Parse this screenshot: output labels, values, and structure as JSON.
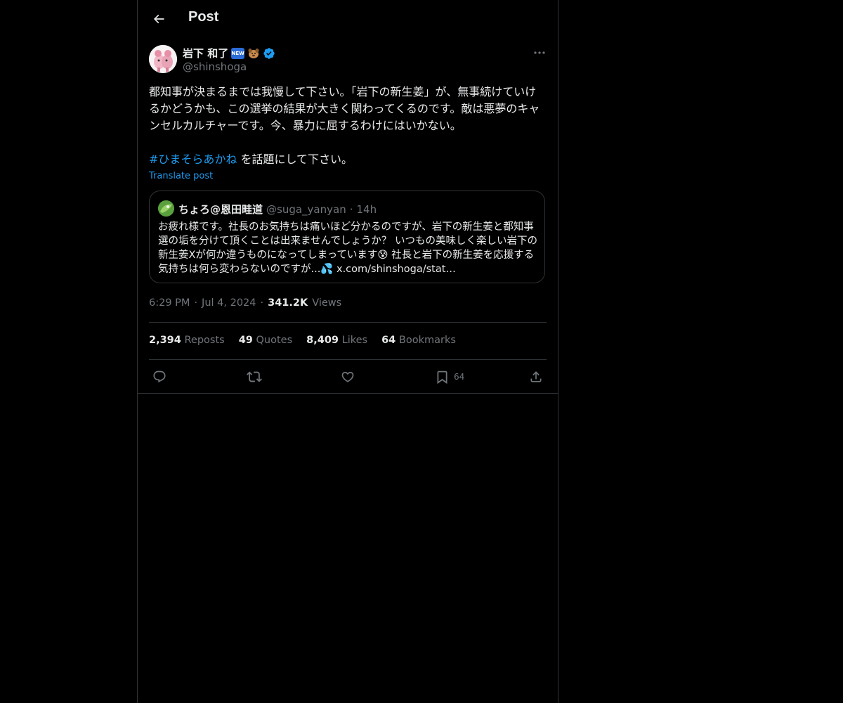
{
  "header": {
    "title": "Post"
  },
  "author": {
    "name": "岩下 和了",
    "badge_new": "NEW",
    "handle": "@shinshoga"
  },
  "post": {
    "text_main": "都知事が決まるまでは我慢して下さい。「岩下の新生姜」が、無事続けていけるかどうかも、この選挙の結果が大きく関わってくるのです。敵は悪夢のキャンセルカルチャーです。今、暴力に屈するわけにはいかない。\n\n",
    "hashtag": "#ひまそらあかね",
    "text_after_hashtag": " を話題にして下さい。",
    "translate_label": "Translate post"
  },
  "quote": {
    "name": "ちょろ@恩田畦道",
    "handle": "@suga_yanyan",
    "dot": "·",
    "time": "14h",
    "text": "お疲れ様です。社長のお気持ちは痛いほど分かるのですが、岩下の新生姜と都知事選の垢を分けて頂くことは出来ませんでしょうか？ いつもの美味しく楽しい岩下の新生姜Xが何か違うものになってしまっています😰 社長と岩下の新生姜を応援する気持ちは何ら変わらないのですが...💦 x.com/shinshoga/stat…"
  },
  "meta": {
    "time": "6:29 PM",
    "dot": "·",
    "date": "Jul 4, 2024",
    "views_count": "341.2K",
    "views_label": "Views"
  },
  "stats": {
    "reposts_count": "2,394",
    "reposts_label": "Reposts",
    "quotes_count": "49",
    "quotes_label": "Quotes",
    "likes_count": "8,409",
    "likes_label": "Likes",
    "bookmarks_count": "64",
    "bookmarks_label": "Bookmarks"
  },
  "actions": {
    "bookmark_count": "64"
  },
  "colors": {
    "accent": "#1d9bf0",
    "verified": "#1d9bf0",
    "muted": "#71767b",
    "border": "#2f3336"
  }
}
